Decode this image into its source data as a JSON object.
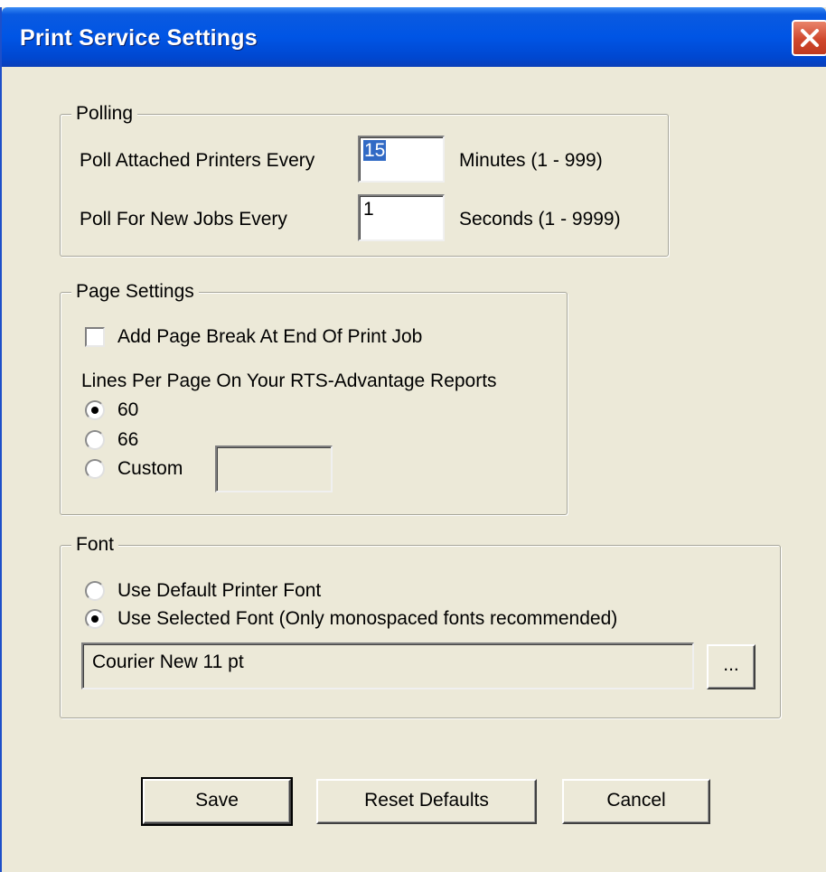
{
  "window": {
    "title": "Print Service Settings"
  },
  "polling": {
    "label": "Polling",
    "printers_label": "Poll Attached Printers Every",
    "printers_value": "15",
    "printers_units": "Minutes (1 - 999)",
    "jobs_label": "Poll For New Jobs Every",
    "jobs_value": "1",
    "jobs_units": "Seconds (1 - 9999)"
  },
  "page_settings": {
    "label": "Page Settings",
    "page_break_label": "Add Page Break At End Of Print Job",
    "page_break_checked": false,
    "lines_label": "Lines Per Page On Your RTS-Advantage Reports",
    "options": [
      "60",
      "66",
      "Custom"
    ],
    "selected": "60",
    "custom_value": ""
  },
  "font": {
    "label": "Font",
    "default_label": "Use Default Printer Font",
    "selected_label": "Use Selected Font (Only monospaced fonts recommended)",
    "selected": "selected",
    "font_value": "Courier New 11 pt",
    "browse_label": "..."
  },
  "buttons": {
    "save": "Save",
    "reset": "Reset Defaults",
    "cancel": "Cancel"
  }
}
